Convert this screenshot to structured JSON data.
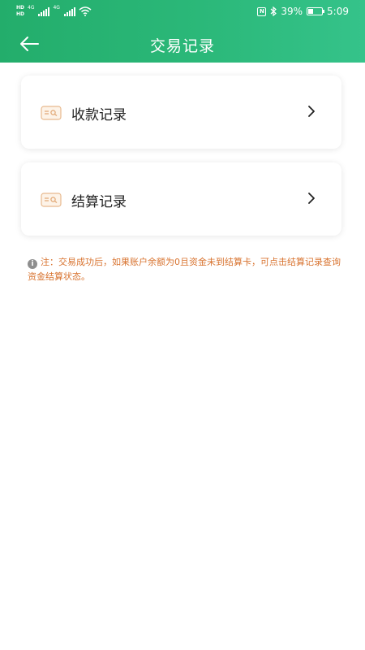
{
  "status_bar": {
    "hd1": "HD",
    "hd2": "HD",
    "net1": "4G",
    "net2": "4G",
    "battery_percent": "39%",
    "battery_level": 0.39,
    "time": "5:09",
    "icons": [
      "hd-icon",
      "signal-icon",
      "wifi-icon",
      "nfc-icon",
      "bluetooth-icon",
      "battery-icon"
    ]
  },
  "header": {
    "title": "交易记录",
    "back_icon": "arrow-left-icon",
    "color": "#2bb879"
  },
  "menu": [
    {
      "label": "收款记录",
      "icon": "card-icon",
      "chevron": "chevron-right-icon"
    },
    {
      "label": "结算记录",
      "icon": "card-icon",
      "chevron": "chevron-right-icon"
    }
  ],
  "note": {
    "text": "注：交易成功后，如果账户余额为0且资金未到结算卡，可点击结算记录查询资金结算状态。",
    "icon": "info-icon",
    "color": "#d8732f"
  }
}
